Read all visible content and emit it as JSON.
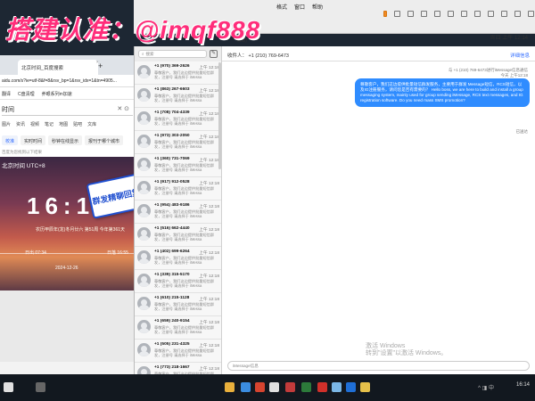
{
  "watermark": {
    "text": "搭建认准：@imqf888"
  },
  "mac": {
    "menu": [
      "格式",
      "窗口",
      "帮助"
    ],
    "menu2": "帮助",
    "status": [
      "周四 上午 12:14"
    ]
  },
  "browser": {
    "tab_title": "北京时间_百度搜索",
    "tab_close": "×",
    "tab_add": "+",
    "url": "aidu.com/s?ie=utf-8&f=8&rsv_bp=1&rsv_idx=1&tn=4905...",
    "bookmarks": [
      "翻译",
      "C盘清理",
      "养眼系列m加速"
    ],
    "search_value": "时间",
    "search_icons": "✕  ⊙",
    "filters": [
      "图片",
      "资讯",
      "视频",
      "笔记",
      "地图",
      "贴吧",
      "文库"
    ],
    "chips": [
      "校准",
      "实时时间",
      "秒钟在线显示",
      "报刊于哪个城市"
    ],
    "result_hint": "百度为您找到以下结果",
    "time_card": {
      "title": "北京时间 UTC+8",
      "time": "16:14",
      "sub": "农历甲辰年(龙)冬月廿六 第51周 今年第361天",
      "sunrise": "日出 07:34",
      "sunset": "日落 16:55",
      "date": "2024-12-26"
    }
  },
  "sticker": {
    "text": "群发精聊回复"
  },
  "messages": {
    "search_placeholder": "搜索",
    "compose_icon": "✎",
    "conversations": [
      {
        "number": "+1 (970) 369-2626",
        "time": "上午 12:18",
        "preview": "尊敬客户，我们这边提供批量短信群发，注册号 请选择于 iMessa"
      },
      {
        "number": "+1 (863) 267-6603",
        "time": "上午 12:18",
        "preview": "尊敬客户，我们这边提供批量短信群发，注册号 请选择于 iMessa"
      },
      {
        "number": "+1 (708) 704-4339",
        "time": "上午 12:18",
        "preview": "尊敬客户，我们这边提供批量短信群发，注册号 请选择于 iMessa"
      },
      {
        "number": "+1 (973) 303-2050",
        "time": "上午 12:18",
        "preview": "尊敬客户，我们这边提供批量短信群发，注册号 请选择于 iMessa"
      },
      {
        "number": "+1 (360) 731-7069",
        "time": "上午 12:18",
        "preview": "尊敬客户，我们这边提供批量短信群发，注册号 请选择于 iMessa"
      },
      {
        "number": "+1 (917) 912-0528",
        "time": "上午 12:18",
        "preview": "尊敬客户，我们这边提供批量短信群发，注册号 请选择于 iMessa"
      },
      {
        "number": "+1 (954) 483-9186",
        "time": "上午 12:18",
        "preview": "尊敬客户，我们这边提供批量短信群发，注册号 请选择于 iMessa"
      },
      {
        "number": "+1 (516) 662-4440",
        "time": "上午 12:18",
        "preview": "尊敬客户，我们这边提供批量短信群发，注册号 请选择于 iMessa"
      },
      {
        "number": "+1 (402) 699-6264",
        "time": "上午 12:18",
        "preview": "尊敬客户，我们这边提供批量短信群发，注册号 请选择于 iMessa"
      },
      {
        "number": "+1 (339) 315-5170",
        "time": "上午 12:18",
        "preview": "尊敬客户，我们这边提供批量短信群发，注册号 请选择于 iMessa"
      },
      {
        "number": "+1 (610) 215-1128",
        "time": "上午 12:18",
        "preview": "尊敬客户，我们这边提供批量短信群发，注册号 请选择于 iMessa"
      },
      {
        "number": "+1 (659) 240-9154",
        "time": "上午 12:18",
        "preview": "尊敬客户，我们这边提供批量短信群发，注册号 请选择于 iMessa"
      },
      {
        "number": "+1 (505) 231-4325",
        "time": "上午 12:18",
        "preview": "尊敬客户，我们这边提供批量短信群发，注册号 请选择于 iMessa"
      },
      {
        "number": "+1 (773) 218-1667",
        "time": "上午 12:18",
        "preview": "尊敬客户，我们这边提供批量短信群发，注册号 请选择于 iMessa"
      }
    ],
    "chat": {
      "to_label": "收件人：",
      "to_number": "+1 (210) 769-6473",
      "details": "详细信息",
      "meta_line1": "与 +1 (210) 769-6473进行iMessage信息通信",
      "meta_line2": "今天 上午12:18",
      "bubble": "尊敬客户，我们这边提供批量短信群发服务，主要用于群发 Message短信，RCS短信，以及IG注册服务，请问您是否有需要的？ Hello boss, we are here to build and install a group messaging system, mainly used for group sending iMessage, RCS text messages, and IG registration software. Do you need mass SMS promotion?",
      "delivered": "已送达",
      "input_placeholder": "iMessage信息"
    }
  },
  "win_watermark": [
    "激活 Windows",
    "转到\"设置\"以激活 Windows。"
  ],
  "taskbar": {
    "clock": "16:14",
    "tray": "^ ◨ 中"
  }
}
